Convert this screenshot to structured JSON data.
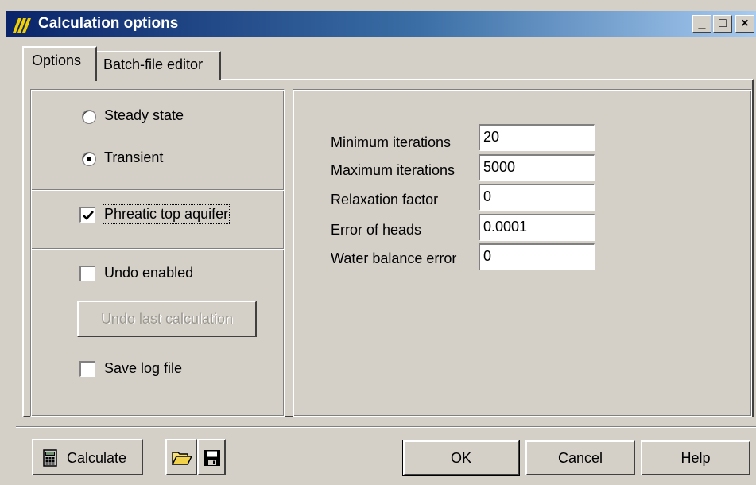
{
  "window": {
    "title": "Calculation options",
    "caption_buttons": [
      "_",
      "□",
      "×"
    ]
  },
  "tabs": [
    {
      "label": "Options",
      "active": true
    },
    {
      "label": "Batch-file editor",
      "active": false
    }
  ],
  "options": {
    "calculation_mode": {
      "steady_state": {
        "label": "Steady state",
        "selected": false
      },
      "transient": {
        "label": "Transient",
        "selected": true
      }
    },
    "phreatic_top_aquifer": {
      "label": "Phreatic top aquifer",
      "checked": true
    },
    "undo_enabled": {
      "label": "Undo enabled",
      "checked": false
    },
    "undo_last_calculation": {
      "label": "Undo last calculation",
      "enabled": false
    },
    "save_log_file": {
      "label": "Save log file",
      "checked": false
    }
  },
  "parameters": [
    {
      "label": "Minimum iterations",
      "value": "20"
    },
    {
      "label": "Maximum iterations",
      "value": "5000"
    },
    {
      "label": "Relaxation factor",
      "value": "0"
    },
    {
      "label": "Error of heads",
      "value": "0.0001"
    },
    {
      "label": "Water balance error",
      "value": "0"
    }
  ],
  "footer": {
    "calculate_label": "Calculate",
    "ok_label": "OK",
    "cancel_label": "Cancel",
    "help_label": "Help"
  },
  "icons": [
    "app-icon",
    "calculator-icon",
    "open-folder-icon",
    "save-disk-icon",
    "checkmark-icon"
  ]
}
